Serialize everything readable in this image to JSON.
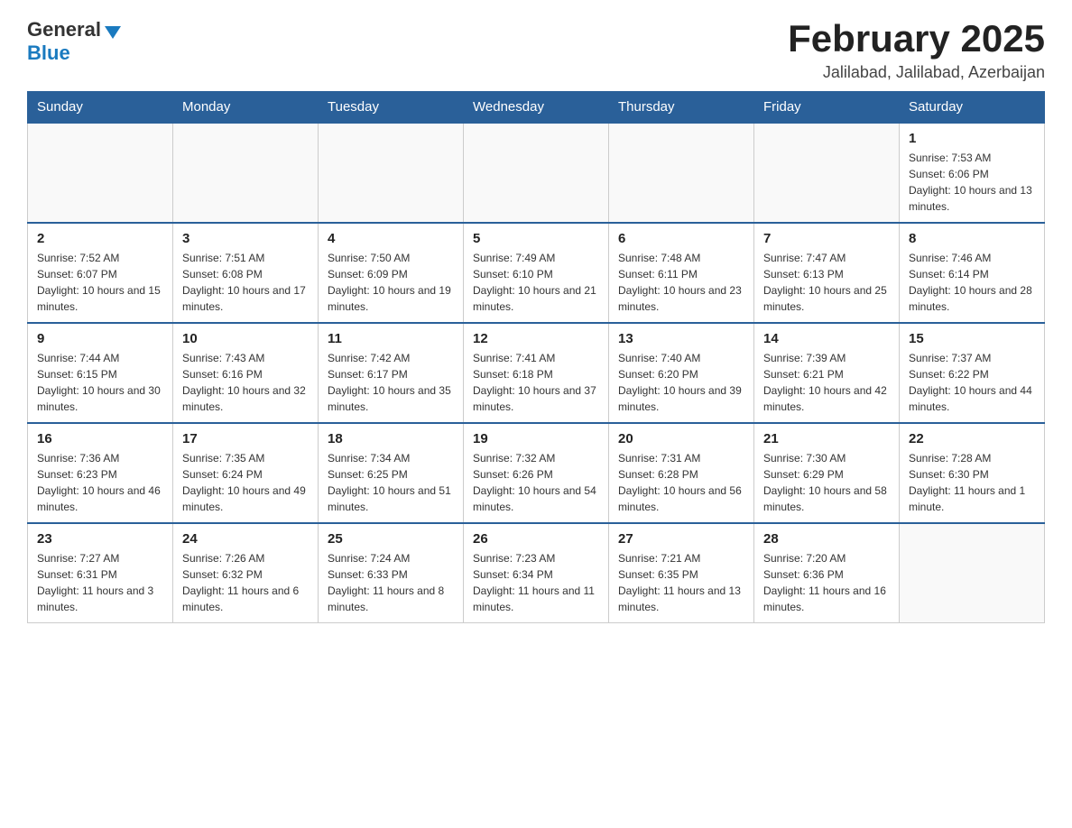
{
  "logo": {
    "general": "General",
    "blue": "Blue"
  },
  "header": {
    "title": "February 2025",
    "location": "Jalilabad, Jalilabad, Azerbaijan"
  },
  "weekdays": [
    "Sunday",
    "Monday",
    "Tuesday",
    "Wednesday",
    "Thursday",
    "Friday",
    "Saturday"
  ],
  "weeks": [
    [
      {
        "day": "",
        "info": ""
      },
      {
        "day": "",
        "info": ""
      },
      {
        "day": "",
        "info": ""
      },
      {
        "day": "",
        "info": ""
      },
      {
        "day": "",
        "info": ""
      },
      {
        "day": "",
        "info": ""
      },
      {
        "day": "1",
        "info": "Sunrise: 7:53 AM\nSunset: 6:06 PM\nDaylight: 10 hours and 13 minutes."
      }
    ],
    [
      {
        "day": "2",
        "info": "Sunrise: 7:52 AM\nSunset: 6:07 PM\nDaylight: 10 hours and 15 minutes."
      },
      {
        "day": "3",
        "info": "Sunrise: 7:51 AM\nSunset: 6:08 PM\nDaylight: 10 hours and 17 minutes."
      },
      {
        "day": "4",
        "info": "Sunrise: 7:50 AM\nSunset: 6:09 PM\nDaylight: 10 hours and 19 minutes."
      },
      {
        "day": "5",
        "info": "Sunrise: 7:49 AM\nSunset: 6:10 PM\nDaylight: 10 hours and 21 minutes."
      },
      {
        "day": "6",
        "info": "Sunrise: 7:48 AM\nSunset: 6:11 PM\nDaylight: 10 hours and 23 minutes."
      },
      {
        "day": "7",
        "info": "Sunrise: 7:47 AM\nSunset: 6:13 PM\nDaylight: 10 hours and 25 minutes."
      },
      {
        "day": "8",
        "info": "Sunrise: 7:46 AM\nSunset: 6:14 PM\nDaylight: 10 hours and 28 minutes."
      }
    ],
    [
      {
        "day": "9",
        "info": "Sunrise: 7:44 AM\nSunset: 6:15 PM\nDaylight: 10 hours and 30 minutes."
      },
      {
        "day": "10",
        "info": "Sunrise: 7:43 AM\nSunset: 6:16 PM\nDaylight: 10 hours and 32 minutes."
      },
      {
        "day": "11",
        "info": "Sunrise: 7:42 AM\nSunset: 6:17 PM\nDaylight: 10 hours and 35 minutes."
      },
      {
        "day": "12",
        "info": "Sunrise: 7:41 AM\nSunset: 6:18 PM\nDaylight: 10 hours and 37 minutes."
      },
      {
        "day": "13",
        "info": "Sunrise: 7:40 AM\nSunset: 6:20 PM\nDaylight: 10 hours and 39 minutes."
      },
      {
        "day": "14",
        "info": "Sunrise: 7:39 AM\nSunset: 6:21 PM\nDaylight: 10 hours and 42 minutes."
      },
      {
        "day": "15",
        "info": "Sunrise: 7:37 AM\nSunset: 6:22 PM\nDaylight: 10 hours and 44 minutes."
      }
    ],
    [
      {
        "day": "16",
        "info": "Sunrise: 7:36 AM\nSunset: 6:23 PM\nDaylight: 10 hours and 46 minutes."
      },
      {
        "day": "17",
        "info": "Sunrise: 7:35 AM\nSunset: 6:24 PM\nDaylight: 10 hours and 49 minutes."
      },
      {
        "day": "18",
        "info": "Sunrise: 7:34 AM\nSunset: 6:25 PM\nDaylight: 10 hours and 51 minutes."
      },
      {
        "day": "19",
        "info": "Sunrise: 7:32 AM\nSunset: 6:26 PM\nDaylight: 10 hours and 54 minutes."
      },
      {
        "day": "20",
        "info": "Sunrise: 7:31 AM\nSunset: 6:28 PM\nDaylight: 10 hours and 56 minutes."
      },
      {
        "day": "21",
        "info": "Sunrise: 7:30 AM\nSunset: 6:29 PM\nDaylight: 10 hours and 58 minutes."
      },
      {
        "day": "22",
        "info": "Sunrise: 7:28 AM\nSunset: 6:30 PM\nDaylight: 11 hours and 1 minute."
      }
    ],
    [
      {
        "day": "23",
        "info": "Sunrise: 7:27 AM\nSunset: 6:31 PM\nDaylight: 11 hours and 3 minutes."
      },
      {
        "day": "24",
        "info": "Sunrise: 7:26 AM\nSunset: 6:32 PM\nDaylight: 11 hours and 6 minutes."
      },
      {
        "day": "25",
        "info": "Sunrise: 7:24 AM\nSunset: 6:33 PM\nDaylight: 11 hours and 8 minutes."
      },
      {
        "day": "26",
        "info": "Sunrise: 7:23 AM\nSunset: 6:34 PM\nDaylight: 11 hours and 11 minutes."
      },
      {
        "day": "27",
        "info": "Sunrise: 7:21 AM\nSunset: 6:35 PM\nDaylight: 11 hours and 13 minutes."
      },
      {
        "day": "28",
        "info": "Sunrise: 7:20 AM\nSunset: 6:36 PM\nDaylight: 11 hours and 16 minutes."
      },
      {
        "day": "",
        "info": ""
      }
    ]
  ]
}
